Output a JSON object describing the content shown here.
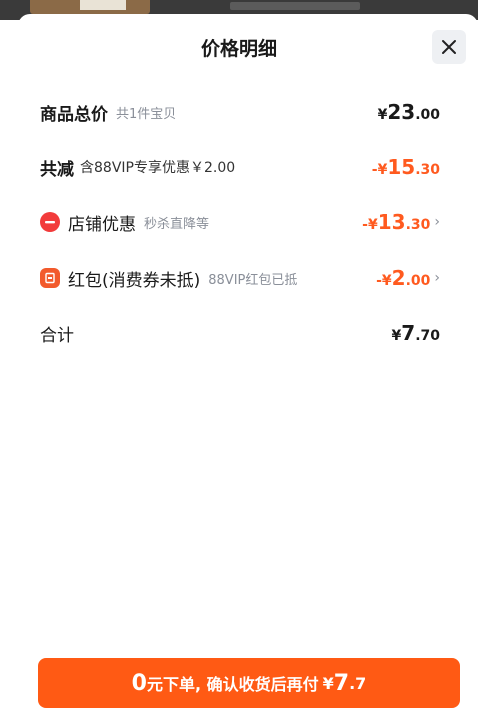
{
  "sheet": {
    "title": "价格明细",
    "close_icon": "close-icon"
  },
  "rows": [
    {
      "label": "商品总价",
      "sub": "共1件宝贝",
      "amount": {
        "currency": "¥",
        "integer": "23",
        "decimal": ".00"
      },
      "color": "#1a1a1a"
    },
    {
      "label": "共减",
      "sub": "含88VIP专享优惠￥2.00",
      "amount": {
        "prefix": "-",
        "currency": "¥",
        "integer": "15",
        "decimal": ".30"
      },
      "color": "#ff5a1f"
    },
    {
      "label": "店铺优惠",
      "sub": "秒杀直降等",
      "icon": "shop-discount-icon",
      "amount": {
        "prefix": "-",
        "currency": "¥",
        "integer": "13",
        "decimal": ".30"
      },
      "chevron": "›",
      "color": "#ff5a1f"
    },
    {
      "label": "红包(消费券未抵)",
      "sub": "88VIP红包已抵",
      "icon": "red-packet-icon",
      "amount": {
        "prefix": "-",
        "currency": "¥",
        "integer": "2",
        "decimal": ".00"
      },
      "chevron": "›",
      "color": "#ff5a1f"
    },
    {
      "label": "合计",
      "amount": {
        "currency": "¥",
        "integer": "7",
        "decimal": ".70"
      },
      "color": "#1a1a1a"
    }
  ],
  "cta": {
    "zero": "0",
    "text": "元下单, 确认收货后再付",
    "currency": "¥",
    "integer": "7",
    "decimal": ".7",
    "color": "#ff5a14"
  }
}
